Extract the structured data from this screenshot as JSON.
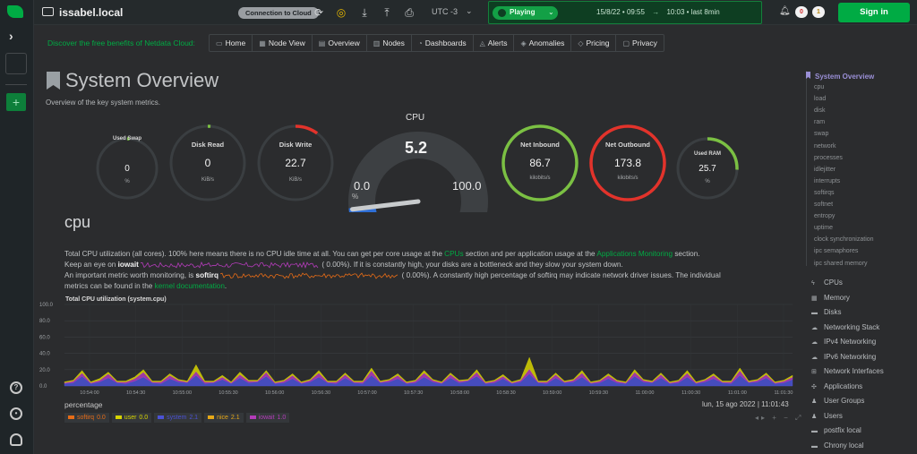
{
  "topbar": {
    "hostname": "issabel.local",
    "connect_label": "Connection to Cloud",
    "timezone": "UTC -3",
    "playing_label": "Playing",
    "date_range_start": "15/8/22 • 09:55",
    "date_range_end": "10:03 • last 8min",
    "arrow": "→",
    "badge_red": "0",
    "badge_yellow": "1",
    "signin_label": "Sign in"
  },
  "nav": {
    "promo": "Discover the free benefits of Netdata Cloud:",
    "items": [
      {
        "label": "Home",
        "icon": "▭"
      },
      {
        "label": "Node View",
        "icon": "▦"
      },
      {
        "label": "Overview",
        "icon": "▤"
      },
      {
        "label": "Nodes",
        "icon": "▥"
      },
      {
        "label": "Dashboards",
        "icon": "◔"
      },
      {
        "label": "Alerts",
        "icon": "◬"
      },
      {
        "label": "Anomalies",
        "icon": "◈"
      },
      {
        "label": "Pricing",
        "icon": "◇"
      },
      {
        "label": "Privacy",
        "icon": "▢"
      }
    ]
  },
  "page": {
    "title": "System Overview",
    "subtitle": "Overview of the key system metrics."
  },
  "gauges": [
    {
      "key": "swap",
      "title": "Used Swap",
      "value": "0",
      "unit": "%",
      "fraction": 0.0,
      "color": "#7bc043"
    },
    {
      "key": "disk-read",
      "title": "Disk Read",
      "value": "0",
      "unit": "KiB/s",
      "fraction": 0.0,
      "color": "#7bc043"
    },
    {
      "key": "disk-write",
      "title": "Disk Write",
      "value": "22.7",
      "unit": "KiB/s",
      "fraction": 0.1,
      "color": "#e2332b"
    },
    {
      "key": "net-in",
      "title": "Net Inbound",
      "value": "86.7",
      "unit": "kilobits/s",
      "fraction": 1.0,
      "color": "#7bc043"
    },
    {
      "key": "net-out",
      "title": "Net Outbound",
      "value": "173.8",
      "unit": "kilobits/s",
      "fraction": 1.0,
      "color": "#e2332b"
    },
    {
      "key": "ram",
      "title": "Used RAM",
      "value": "25.7",
      "unit": "%",
      "fraction": 0.257,
      "color": "#7bc043"
    }
  ],
  "cpu_gauge": {
    "title": "CPU",
    "value": "5.2",
    "value_num": 5.2,
    "min": "0.0",
    "max": "100.0",
    "unit": "%"
  },
  "cpu_section": {
    "title": "cpu",
    "line1_pre": "Total CPU utilization (all cores). 100% here means there is no CPU idle time at all. You can get per core usage at the ",
    "line1_link1": "CPUs",
    "line1_mid": " section and per application usage at the ",
    "line1_link2": "Applications Monitoring",
    "line1_post": " section.",
    "line2_pre": "Keep an eye on ",
    "line2_bold": "iowait",
    "line2_val": "( 0.00%)",
    "line2_post": ". If it is constantly high, your disks are a bottleneck and they slow your system down.",
    "line3_pre": "An important metric worth monitoring, is ",
    "line3_bold": "softirq",
    "line3_val": "( 0.00%)",
    "line3_post": ". A constantly high percentage of softirq may indicate network driver issues. The individual",
    "line4_pre": "metrics can be found in the ",
    "line4_link": "kernel documentation",
    "line4_post": "."
  },
  "chart": {
    "title": "Total CPU utilization (system.cpu)",
    "ylabel": "percentage",
    "date_label": "lun, 15 ago 2022 | 11:01:43",
    "controls": "◂▸ + − ⤢",
    "legend": [
      {
        "name": "softirq",
        "value": "0.0",
        "color": "#e66c17"
      },
      {
        "name": "user",
        "value": "0.0",
        "color": "#d7d400"
      },
      {
        "name": "system",
        "value": "2.1",
        "color": "#4b52d6"
      },
      {
        "name": "nice",
        "value": "2.1",
        "color": "#e6a817"
      },
      {
        "name": "iowait",
        "value": "1.0",
        "color": "#b33cb9"
      }
    ]
  },
  "chart_data": {
    "type": "area",
    "title": "Total CPU utilization (system.cpu)",
    "ylabel": "percentage",
    "ylim": [
      0,
      100
    ],
    "y_ticks": [
      "100.0",
      "80.0",
      "60.0",
      "40.0",
      "20.0",
      "0.0"
    ],
    "x_ticks": [
      "10:54:00",
      "10:54:30",
      "10:55:00",
      "10:55:30",
      "10:56:00",
      "10:56:30",
      "10:57:00",
      "10:57:30",
      "10:58:00",
      "10:58:30",
      "10:59:00",
      "10:59:30",
      "11:00:00",
      "11:00:30",
      "11:01:00",
      "11:01:30"
    ],
    "series": [
      {
        "name": "system",
        "values": [
          3,
          4,
          12,
          3,
          5,
          10,
          4,
          3,
          6,
          11,
          4,
          3,
          9,
          5,
          4,
          13,
          3,
          4,
          8,
          3,
          10,
          4,
          5,
          12,
          3,
          4,
          9,
          3,
          5,
          11,
          4,
          3,
          10,
          4,
          3,
          13,
          4,
          5,
          9,
          3,
          4,
          11,
          5,
          3,
          10,
          4,
          6,
          12,
          3,
          4,
          9,
          3,
          5,
          15,
          4,
          3,
          10,
          4,
          5,
          11,
          3,
          4,
          9,
          4,
          3,
          12,
          5,
          4,
          10,
          3,
          4,
          11,
          3,
          5,
          9,
          4,
          3,
          13,
          4,
          5,
          10,
          3,
          4,
          8
        ]
      },
      {
        "name": "iowait",
        "values": [
          1,
          2,
          4,
          1,
          2,
          5,
          1,
          2,
          3,
          6,
          1,
          2,
          4,
          2,
          1,
          5,
          2,
          1,
          3,
          1,
          4,
          2,
          1,
          5,
          1,
          2,
          4,
          1,
          2,
          5,
          1,
          2,
          4,
          1,
          2,
          6,
          1,
          2,
          4,
          1,
          2,
          5,
          2,
          1,
          4,
          2,
          1,
          5,
          1,
          2,
          3,
          1,
          2,
          6,
          1,
          2,
          4,
          1,
          2,
          5,
          1,
          2,
          4,
          2,
          1,
          5,
          2,
          1,
          4,
          1,
          2,
          5,
          1,
          2,
          4,
          1,
          2,
          6,
          1,
          2,
          4,
          1,
          2,
          3
        ]
      },
      {
        "name": "user",
        "values": [
          1,
          1,
          3,
          1,
          2,
          2,
          1,
          1,
          2,
          3,
          1,
          1,
          2,
          1,
          1,
          8,
          1,
          1,
          2,
          1,
          3,
          1,
          1,
          2,
          1,
          1,
          2,
          1,
          1,
          3,
          1,
          1,
          2,
          1,
          1,
          3,
          1,
          1,
          2,
          1,
          1,
          3,
          1,
          1,
          2,
          1,
          1,
          3,
          1,
          1,
          2,
          1,
          1,
          14,
          1,
          1,
          2,
          1,
          1,
          3,
          1,
          1,
          2,
          1,
          1,
          3,
          1,
          1,
          2,
          1,
          1,
          3,
          1,
          1,
          2,
          1,
          1,
          3,
          1,
          1,
          2,
          1,
          1,
          2
        ]
      }
    ]
  },
  "toc": {
    "active": "System Overview",
    "sub_items": [
      "cpu",
      "load",
      "disk",
      "ram",
      "swap",
      "network",
      "processes",
      "idlejitter",
      "interrupts",
      "softirqs",
      "softnet",
      "entropy",
      "uptime",
      "clock synchronization",
      "ipc semaphores",
      "ipc shared memory"
    ],
    "sections": [
      {
        "label": "CPUs",
        "icon": "ϟ"
      },
      {
        "label": "Memory",
        "icon": "▦"
      },
      {
        "label": "Disks",
        "icon": "▬"
      },
      {
        "label": "Networking Stack",
        "icon": "☁"
      },
      {
        "label": "IPv4 Networking",
        "icon": "☁"
      },
      {
        "label": "IPv6 Networking",
        "icon": "☁"
      },
      {
        "label": "Network Interfaces",
        "icon": "⊞"
      },
      {
        "label": "Applications",
        "icon": "✣"
      },
      {
        "label": "User Groups",
        "icon": "♟"
      },
      {
        "label": "Users",
        "icon": "♟"
      },
      {
        "label": "postfix local",
        "icon": "▬"
      },
      {
        "label": "Chrony local",
        "icon": "▬"
      }
    ]
  },
  "icons": {
    "rail": [
      "netdata-logo-icon",
      "chevron-right-icon",
      "space-box",
      "add-icon",
      "help-icon",
      "settings-icon",
      "user-icon"
    ],
    "topbar": [
      "server-icon",
      "refresh-icon",
      "lightbulb-icon",
      "download-icon",
      "upload-icon",
      "print-icon",
      "bell-icon"
    ]
  }
}
